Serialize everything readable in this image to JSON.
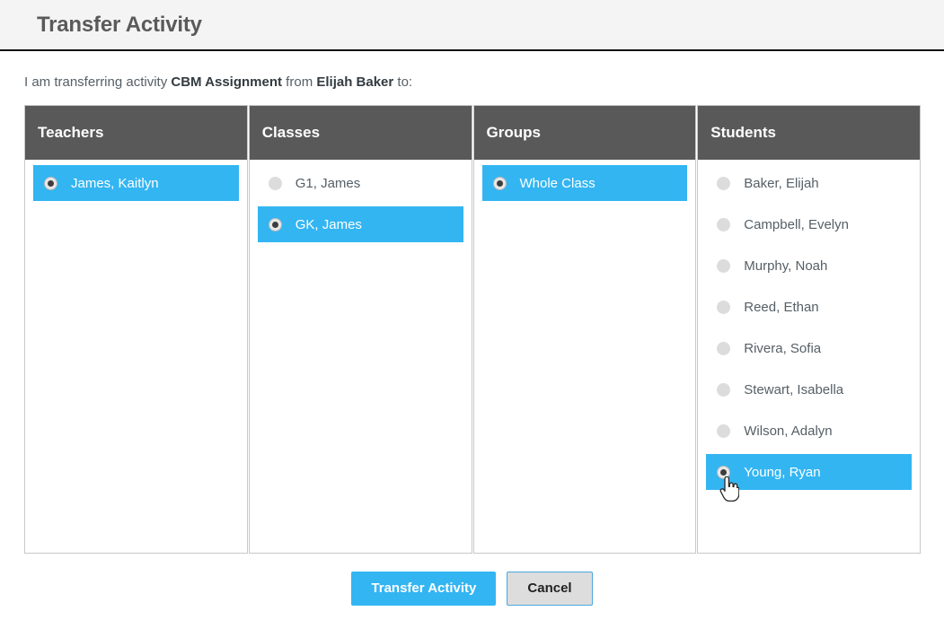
{
  "header": {
    "title": "Transfer Activity"
  },
  "sentence": {
    "prefix": "I am transferring activity ",
    "activity": "CBM Assignment",
    "middle": " from ",
    "from_person": "Elijah Baker",
    "suffix": " to:"
  },
  "colors": {
    "accent": "#33b5f2",
    "header_bar": "#595959",
    "page_header_bg": "#f4f4f4",
    "text": "#555f66",
    "radio_unselected": "#dcdcdc",
    "cancel_bg": "#dddddd"
  },
  "columns": [
    {
      "title": "Teachers",
      "name": "teachers",
      "items": [
        {
          "label": "James, Kaitlyn",
          "selected": true
        }
      ]
    },
    {
      "title": "Classes",
      "name": "classes",
      "items": [
        {
          "label": "G1, James",
          "selected": false
        },
        {
          "label": "GK, James",
          "selected": true
        }
      ]
    },
    {
      "title": "Groups",
      "name": "groups",
      "items": [
        {
          "label": "Whole Class",
          "selected": true
        }
      ]
    },
    {
      "title": "Students",
      "name": "students",
      "items": [
        {
          "label": "Baker, Elijah",
          "selected": false
        },
        {
          "label": "Campbell, Evelyn",
          "selected": false
        },
        {
          "label": "Murphy, Noah",
          "selected": false
        },
        {
          "label": "Reed, Ethan",
          "selected": false
        },
        {
          "label": "Rivera, Sofia",
          "selected": false
        },
        {
          "label": "Stewart, Isabella",
          "selected": false
        },
        {
          "label": "Wilson, Adalyn",
          "selected": false
        },
        {
          "label": "Young, Ryan",
          "selected": true
        }
      ]
    }
  ],
  "footer": {
    "submit_label": "Transfer Activity",
    "cancel_label": "Cancel"
  },
  "cursor": {
    "icon": "pointing-hand-cursor"
  }
}
